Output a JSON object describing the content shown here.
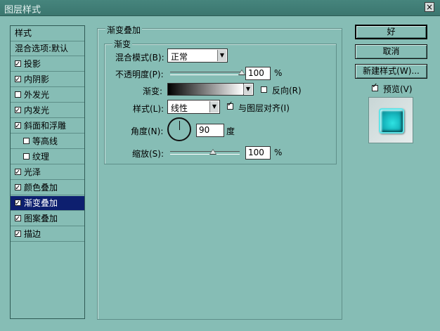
{
  "window": {
    "title": "图层样式",
    "close_glyph": "×"
  },
  "left_list": [
    {
      "label": "样式",
      "checkbox": false,
      "checked": false,
      "indent": false,
      "selected": false
    },
    {
      "label": "混合选项:默认",
      "checkbox": false,
      "checked": false,
      "indent": false,
      "selected": false
    },
    {
      "label": "投影",
      "checkbox": true,
      "checked": true,
      "indent": false,
      "selected": false
    },
    {
      "label": "内阴影",
      "checkbox": true,
      "checked": true,
      "indent": false,
      "selected": false
    },
    {
      "label": "外发光",
      "checkbox": true,
      "checked": false,
      "indent": false,
      "selected": false
    },
    {
      "label": "内发光",
      "checkbox": true,
      "checked": true,
      "indent": false,
      "selected": false
    },
    {
      "label": "斜面和浮雕",
      "checkbox": true,
      "checked": true,
      "indent": false,
      "selected": false
    },
    {
      "label": "等高线",
      "checkbox": true,
      "checked": false,
      "indent": true,
      "selected": false
    },
    {
      "label": "纹理",
      "checkbox": true,
      "checked": false,
      "indent": true,
      "selected": false
    },
    {
      "label": "光泽",
      "checkbox": true,
      "checked": true,
      "indent": false,
      "selected": false
    },
    {
      "label": "颜色叠加",
      "checkbox": true,
      "checked": true,
      "indent": false,
      "selected": false
    },
    {
      "label": "渐变叠加",
      "checkbox": true,
      "checked": true,
      "indent": false,
      "selected": true
    },
    {
      "label": "图案叠加",
      "checkbox": true,
      "checked": true,
      "indent": false,
      "selected": false
    },
    {
      "label": "描边",
      "checkbox": true,
      "checked": true,
      "indent": false,
      "selected": false
    }
  ],
  "main": {
    "group_title": "渐变叠加",
    "subgroup_title": "渐变",
    "blend_mode": {
      "label": "混合模式(B):",
      "value": "正常"
    },
    "opacity": {
      "label": "不透明度(P):",
      "value": "100",
      "unit": "%",
      "level": 100
    },
    "gradient": {
      "label": "渐变:",
      "reverse_label": "反向(R)",
      "reverse_checked": false
    },
    "style": {
      "label": "样式(L):",
      "value": "线性",
      "align_label": "与图层对齐(I)",
      "align_checked": true
    },
    "angle": {
      "label": "角度(N):",
      "value": "90",
      "unit": "度"
    },
    "scale": {
      "label": "缩放(S):",
      "value": "100",
      "unit": "%",
      "level": 100
    }
  },
  "buttons": {
    "ok": "好",
    "cancel": "取消",
    "new_style": "新建样式(W)...",
    "preview_label": "预览(V)",
    "preview_checked": true
  }
}
